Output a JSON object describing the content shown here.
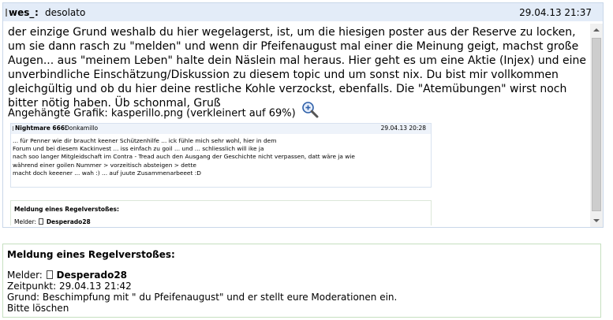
{
  "post": {
    "author": "wes_",
    "separator": ":",
    "subject": "desolato",
    "timestamp": "29.04.13 21:37",
    "body": "der einzige Grund weshalb du hier wegelagerst, ist, um die hiesigen poster aus der Reserve zu locken, um sie dann rasch zu \"melden\" und wenn dir Pfeifenaugust mal einer die Meinung geigt, machst große Augen... aus \"meinem Leben\" halte dein Näslein mal heraus. Hier geht es um eine Aktie (Injex) und eine unverbindliche Einschätzung/Diskussion zu diesem topic und um sonst nix. Du bist mir vollkommen gleichgültig und ob du hier deine restliche Kohle verzockst, ebenfalls. Die \"Atemübungen\" wirst noch bitter nötig haben. Üb schonmal, Gruß",
    "attachment_label": "Angehängte Grafik: kasperillo.png (verkleinert auf 69%)",
    "zoom_icon": "magnifier-plus-icon"
  },
  "embedded_image": {
    "author": "Nightmare 666:",
    "subject": "Donkamillo",
    "timestamp": "29.04.13 20:28",
    "lines": [
      "... für Penner wie dir braucht keener Schützenhilfe ... ick fühle mich sehr wohl, hier in dem",
      "Forum und bei diesem Kackinvest ... iss einfach zu goil ... und ... schliesslich will ike ja",
      "nach soo langer Mitgleidschaft im Contra - Tread auch den Ausgang der Geschichte nicht verpassen, datt wäre ja wie",
      "während einer goilen Nummer > vorzeitisch absteigen > dette",
      "macht doch keeener ...  wah :)  ... auf juute Zusammenarbeeet :D"
    ],
    "report_title": "Meldung eines Regelverstoßes:",
    "report_reporter_label": "Melder:",
    "report_reporter_name": "Desperado28"
  },
  "report": {
    "title": "Meldung eines Regelverstoßes:",
    "reporter_label": "Melder:",
    "reporter_name": "Desperado28",
    "time_line": "Zeitpunkt: 29.04.13 21:42",
    "reason_line": "Grund: Beschimpfung mit \" du Pfeifenaugust\" und er stellt eure Moderationen ein.",
    "action_line": "Bitte löschen"
  },
  "colors": {
    "header_bg": "#e3ecf8",
    "post_border": "#c9d7e9",
    "report_border": "#c6e0c0"
  }
}
